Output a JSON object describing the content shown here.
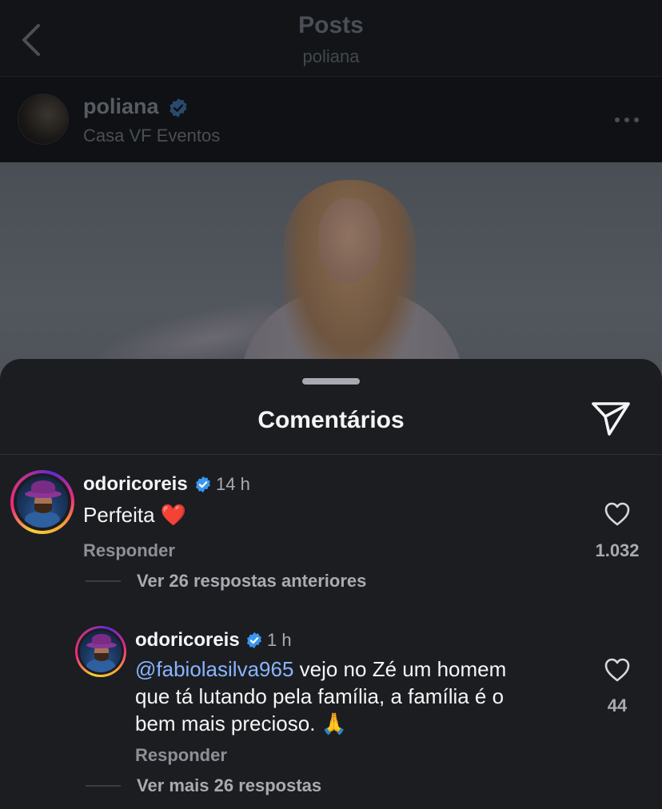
{
  "header": {
    "title": "Posts",
    "subtitle": "poliana"
  },
  "post": {
    "username": "poliana",
    "location": "Casa VF Eventos"
  },
  "comments_sheet": {
    "title": "Comentários",
    "comments": [
      {
        "username": "odoricoreis",
        "time": "14 h",
        "text": "Perfeita",
        "emoji": "❤️",
        "reply_label": "Responder",
        "likes": "1.032",
        "view_replies_label": "Ver 26 respostas anteriores"
      }
    ],
    "reply": {
      "username": "odoricoreis",
      "time": "1 h",
      "mention": "@fabiolasilva965",
      "text_line1": " vejo no Zé um homem",
      "text_line2": "que tá lutando pela família, a família é o",
      "text_line3": "bem mais precioso. ",
      "emoji": "🙏",
      "reply_label": "Responder",
      "likes": "44",
      "view_more_label": "Ver mais 26 respostas"
    }
  },
  "colors": {
    "verified": "#3897f0",
    "mention": "#8ab4ff",
    "heart_emoji": "#e0243a"
  },
  "icons": [
    "back-chevron-icon",
    "verified-badge-icon",
    "more-dots-icon",
    "share-send-icon",
    "heart-outline-icon"
  ]
}
